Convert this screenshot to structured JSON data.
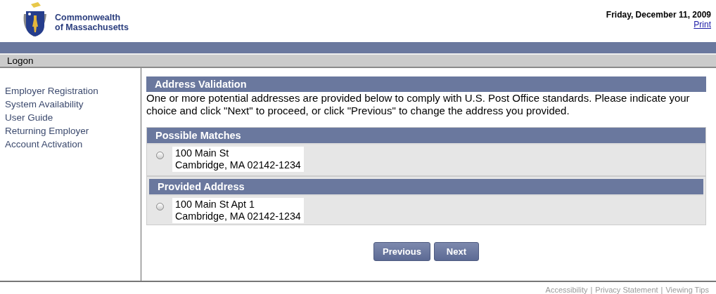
{
  "header": {
    "agency_name": [
      "Commonwealth",
      "of Massachusetts"
    ],
    "date": "Friday, December 11, 2009",
    "print_link": "Print"
  },
  "nav_bar": {
    "title": "Logon"
  },
  "sidebar": {
    "items": [
      {
        "label": "Employer Registration"
      },
      {
        "label": "System Availability"
      },
      {
        "label": "User Guide"
      },
      {
        "label": "Returning Employer"
      },
      {
        "label": "Account Activation"
      }
    ]
  },
  "content": {
    "title": "Address Validation",
    "instructions": "One or more potential addresses are provided below to comply with U.S. Post Office standards. Please indicate your choice and click \"Next\" to proceed, or click \"Previous\" to change the address you provided.",
    "sections": [
      {
        "title": "Possible Matches",
        "options": [
          {
            "lines": [
              "100 Main St",
              "Cambridge, MA 02142-1234"
            ],
            "selected": false
          }
        ]
      },
      {
        "title": "Provided Address",
        "options": [
          {
            "lines": [
              "100 Main St Apt 1",
              "Cambridge, MA 02142-1234"
            ],
            "selected": false
          }
        ]
      }
    ],
    "buttons": [
      "Previous",
      "Next"
    ]
  },
  "footer": {
    "links": [
      "Accessibility",
      "Privacy Statement",
      "Viewing Tips"
    ],
    "separator": "|"
  }
}
